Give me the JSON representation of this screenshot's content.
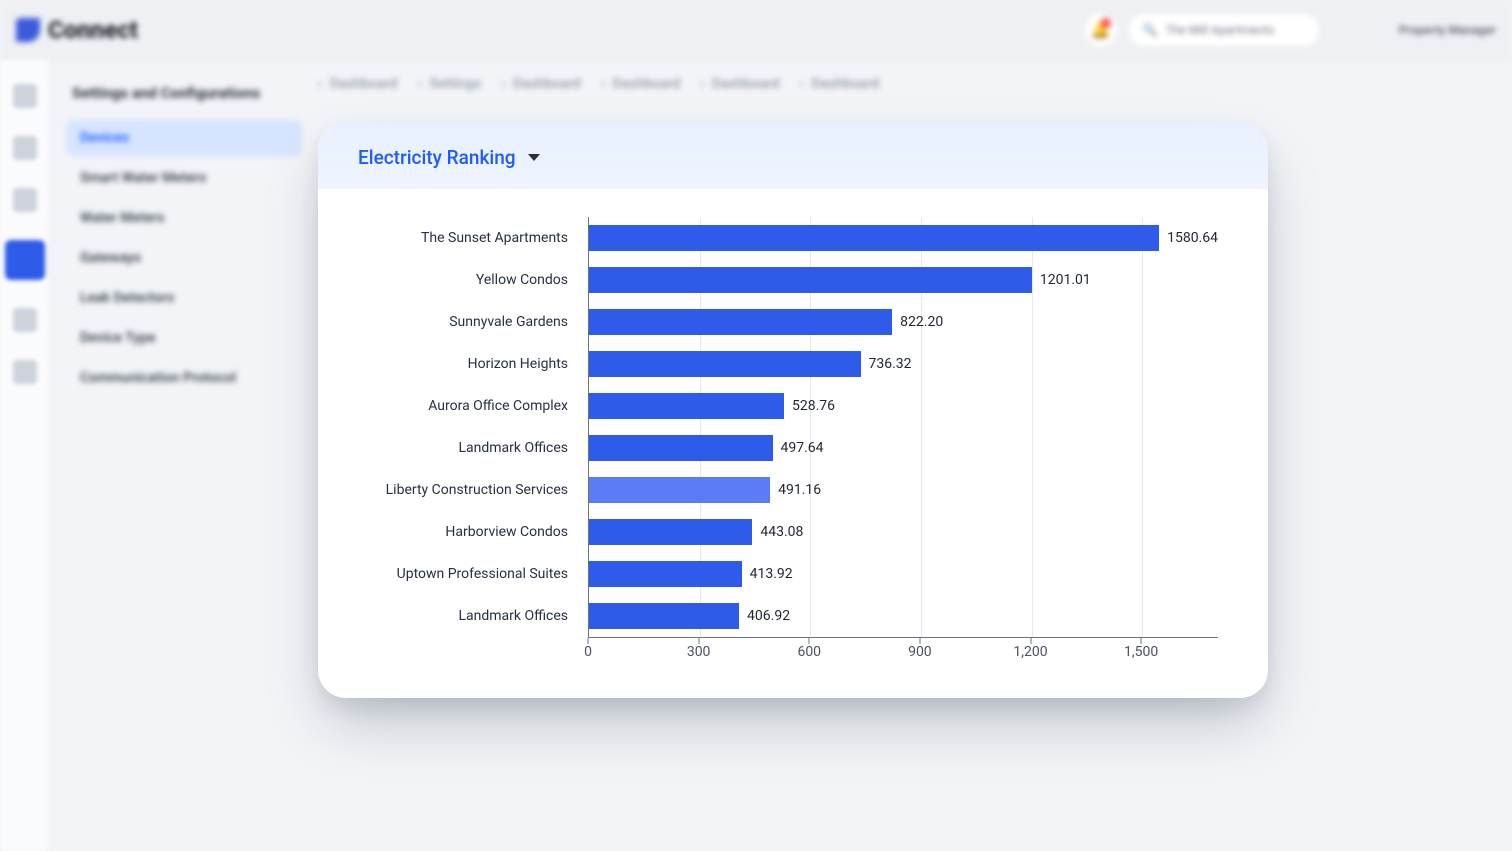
{
  "header": {
    "brand": "Connect",
    "search_placeholder": "The Mill Apartments",
    "user_role": "Property Manager"
  },
  "sidebar": {
    "title": "Settings and Configurations",
    "items": [
      {
        "label": "Devices",
        "active": true
      },
      {
        "label": "Smart Water Meters",
        "active": false
      },
      {
        "label": "Water Meters",
        "active": false
      },
      {
        "label": "Gateways",
        "active": false
      },
      {
        "label": "Leak Detectors",
        "active": false
      },
      {
        "label": "Device Type",
        "active": false
      },
      {
        "label": "Communication Protocol",
        "active": false
      }
    ]
  },
  "breadcrumbs": [
    "Dashboard",
    "Settings",
    "Dashboard",
    "Dashboard",
    "Dashboard",
    "Dashboard"
  ],
  "card": {
    "title": "Electricity Ranking"
  },
  "chart_data": {
    "type": "bar",
    "orientation": "horizontal",
    "title": "Electricity Ranking",
    "xlabel": "",
    "ylabel": "",
    "xlim": [
      0,
      1600
    ],
    "x_ticks": [
      0,
      300,
      600,
      900,
      1200,
      1500
    ],
    "x_tick_labels": [
      "0",
      "300",
      "600",
      "900",
      "1,200",
      "1,500"
    ],
    "categories": [
      "The Sunset Apartments",
      "Yellow Condos",
      "Sunnyvale Gardens",
      "Horizon Heights",
      "Aurora Office Complex",
      "Landmark Offices",
      "Liberty Construction Services",
      "Harborview Condos",
      "Uptown Professional Suites",
      "Landmark Offices"
    ],
    "values": [
      1580.64,
      1201.01,
      822.2,
      736.32,
      528.76,
      497.64,
      491.16,
      443.08,
      413.92,
      406.92
    ],
    "highlight_index": 6,
    "bar_color": "#2f5bea",
    "highlight_color": "#5b7cf6"
  }
}
